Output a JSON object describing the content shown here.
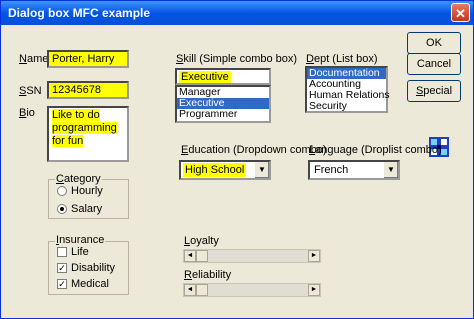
{
  "window": {
    "title": "Dialog box MFC example",
    "close_glyph": "✕"
  },
  "fields": {
    "name": {
      "label_u": "N",
      "label_rest": "ame",
      "value": "Porter, Harry"
    },
    "ssn": {
      "label_u": "S",
      "label_rest": "SN",
      "value": "12345678"
    },
    "bio": {
      "label_u": "B",
      "label_rest": "io",
      "value": "Like to do programming for fun"
    }
  },
  "skill": {
    "label_u": "S",
    "label_rest": "kill (Simple combo box)",
    "value": "Executive",
    "items": [
      "Manager",
      "Executive",
      "Programmer"
    ],
    "selected_index": 1
  },
  "dept": {
    "label_u": "D",
    "label_rest": "ept (List box)",
    "items": [
      "Documentation",
      "Accounting",
      "Human Relations",
      "Security"
    ],
    "selected_index": 0
  },
  "buttons": {
    "ok": "OK",
    "cancel": "Cancel",
    "special_u": "S",
    "special_rest": "pecial"
  },
  "education": {
    "label_u": "E",
    "label_rest": "ducation (Dropdown combo)",
    "value": "High School"
  },
  "language": {
    "label_u": "L",
    "label_rest": "anguage (Droplist combo)",
    "value": "French"
  },
  "category": {
    "title_u": "C",
    "title_rest": "ategory",
    "options": [
      {
        "label": "Hourly",
        "checked": false
      },
      {
        "label": "Salary",
        "checked": true
      }
    ]
  },
  "insurance": {
    "title_u": "I",
    "title_rest": "nsurance",
    "options": [
      {
        "label": "Life",
        "checked": false
      },
      {
        "label": "Disability",
        "checked": true
      },
      {
        "label": "Medical",
        "checked": true
      }
    ]
  },
  "loyalty": {
    "label_u": "L",
    "label_rest": "oyalty",
    "position": 0
  },
  "reliability": {
    "label_u": "R",
    "label_rest": "eliability",
    "position": 0
  },
  "icons": {
    "app": "mfc-app-icon",
    "dropdown": "▼",
    "left": "◄",
    "right": "►",
    "check": "✓"
  },
  "colors": {
    "highlight": "#ffff00",
    "selection": "#316ac5",
    "titlebar": "#0054e3"
  }
}
